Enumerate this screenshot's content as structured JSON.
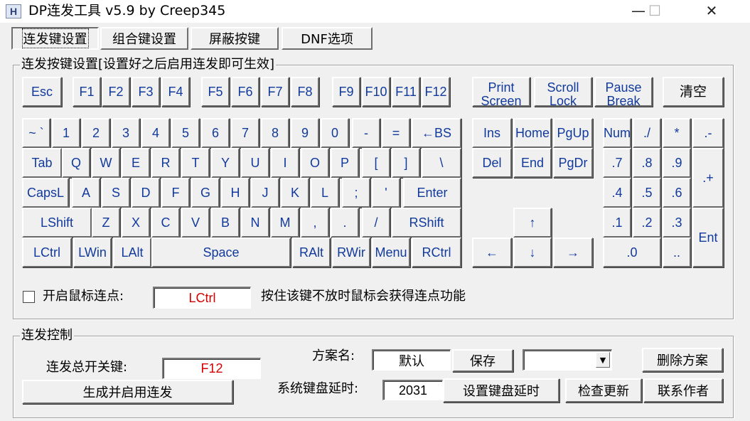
{
  "window": {
    "title": "DP连发工具 v5.9 by Creep345",
    "icon": "H",
    "minimize": "—",
    "maximize": "☐",
    "close": "✕"
  },
  "tabs": [
    {
      "label": "连发键设置",
      "active": true
    },
    {
      "label": "组合键设置",
      "active": false
    },
    {
      "label": "屏蔽按键",
      "active": false
    },
    {
      "label": "DNF选项",
      "active": false
    }
  ],
  "keyboard_group": {
    "legend": "连发按键设置[设置好之后启用连发即可生效]",
    "keys": {
      "esc": "Esc",
      "f1": "F1",
      "f2": "F2",
      "f3": "F3",
      "f4": "F4",
      "f5": "F5",
      "f6": "F6",
      "f7": "F7",
      "f8": "F8",
      "f9": "F9",
      "f10": "F10",
      "f11": "F11",
      "f12": "F12",
      "print_screen": "Print\nScreen",
      "scroll_lock": "Scroll\nLock",
      "pause_break": "Pause\nBreak",
      "clear": "清空",
      "tilde": "~ `",
      "d1": "1",
      "d2": "2",
      "d3": "3",
      "d4": "4",
      "d5": "5",
      "d6": "6",
      "d7": "7",
      "d8": "8",
      "d9": "9",
      "d0": "0",
      "minus": "-",
      "equals": "=",
      "backspace": "←BS",
      "tab": "Tab",
      "q": "Q",
      "w": "W",
      "e": "E",
      "r": "R",
      "t": "T",
      "y": "Y",
      "u": "U",
      "i": "I",
      "o": "O",
      "p": "P",
      "lbracket": "[",
      "rbracket": "]",
      "backslash": "\\",
      "caps": "CapsL",
      "a": "A",
      "s": "S",
      "d": "D",
      "f": "F",
      "g": "G",
      "h": "H",
      "j": "J",
      "k": "K",
      "l": "L",
      "semicolon": ";",
      "quote": "'",
      "enter": "Enter",
      "lshift": "LShift",
      "z": "Z",
      "x": "X",
      "c": "C",
      "v": "V",
      "b": "B",
      "n": "N",
      "m": "M",
      "comma": ",",
      "period": ".",
      "slash": "/",
      "rshift": "RShift",
      "lctrl": "LCtrl",
      "lwin": "LWin",
      "lalt": "LAlt",
      "space": "Space",
      "ralt": "RAlt",
      "rwin": "RWir",
      "menu": "Menu",
      "rctrl": "RCtrl",
      "ins": "Ins",
      "home": "Home",
      "pgup": "PgUp",
      "del": "Del",
      "end": "End",
      "pgdn": "PgDr",
      "up": "↑",
      "left": "←",
      "down": "↓",
      "right": "→",
      "num": "Num",
      "num_div": "./",
      "num_mul": "*",
      "num_sub": ".-",
      "num7": ".7",
      "num8": ".8",
      "num9": ".9",
      "num_add": ".+",
      "num4": ".4",
      "num5": ".5",
      "num6": ".6",
      "num1": ".1",
      "num2": ".2",
      "num3": ".3",
      "num_enter": "Ent",
      "num0": ".0",
      "num_dot": ".."
    },
    "mouse_click": {
      "label": "开启鼠标连点:",
      "value": "LCtrl",
      "hint": "按住该键不放时鼠标会获得连点功能",
      "checked": false
    }
  },
  "control_group": {
    "legend": "连发控制",
    "master_key_label": "连发总开关键:",
    "master_key_value": "F12",
    "generate_button": "生成并启用连发",
    "scheme_label": "方案名:",
    "scheme_value": "默认",
    "save_button": "保存",
    "scheme_select_value": "",
    "delete_button": "删除方案",
    "delay_label": "系统键盘延时:",
    "delay_value": "2031",
    "set_delay_button": "设置键盘延时",
    "check_update_button": "检查更新",
    "contact_button": "联系作者"
  },
  "colors": {
    "key_text": "#123a9c",
    "field_red": "#d40000",
    "face": "#f0f0f0"
  }
}
